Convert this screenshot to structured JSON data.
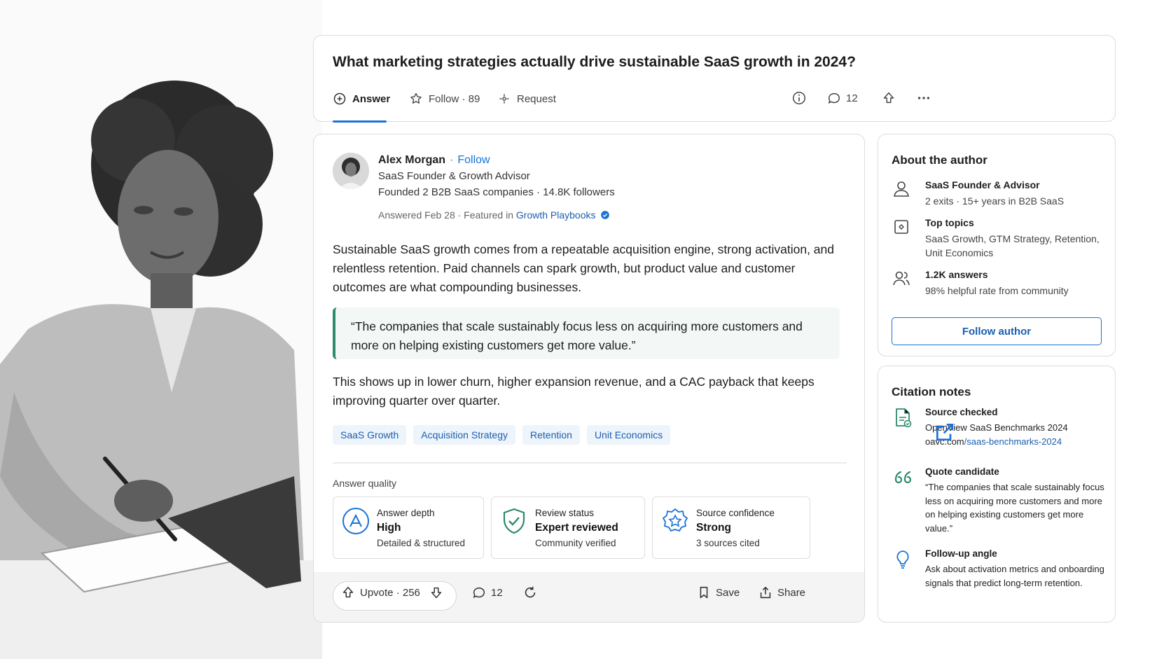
{
  "question": {
    "title": "What marketing strategies actually drive sustainable SaaS growth in 2024?",
    "actions": {
      "answer": "Answer",
      "follow": "Follow · 89",
      "request": "Request",
      "comments": "12"
    }
  },
  "answer": {
    "author": {
      "name": "Alex Morgan",
      "sep": "·",
      "follow": "Follow",
      "title": "SaaS Founder & Growth Advisor",
      "bio": "Founded 2 B2B SaaS companies · 14.8K followers",
      "meta_prefix": "Answered Feb 28 · Featured in ",
      "meta_link": "Growth Playbooks"
    },
    "paragraph1": "Sustainable SaaS growth comes from a repeatable acquisition engine, strong activation, and relentless retention. Paid channels can spark growth, but product value and customer outcomes are what compounding businesses.",
    "quote": "“The companies that scale sustainably focus less on acquiring more customers and more on helping existing customers get more value.”",
    "paragraph2": "This shows up in lower churn, higher expansion revenue, and a CAC payback that keeps improving quarter over quarter.",
    "tags": [
      "SaaS Growth",
      "Acquisition Strategy",
      "Retention",
      "Unit Economics"
    ],
    "quality_label": "Answer quality",
    "quality": [
      {
        "label": "Answer depth",
        "value": "High",
        "note": "Detailed & structured"
      },
      {
        "label": "Review status",
        "value": "Expert reviewed",
        "note": "Community verified"
      },
      {
        "label": "Source confidence",
        "value": "Strong",
        "note": "3 sources cited"
      }
    ],
    "footer": {
      "upvote": "Upvote · 256",
      "comments": "12",
      "save": "Save",
      "share": "Share"
    }
  },
  "about": {
    "heading": "About the author",
    "items": [
      {
        "title": "SaaS Founder & Advisor",
        "desc": "2 exits · 15+ years in B2B SaaS"
      },
      {
        "title": "Top topics",
        "desc": "SaaS Growth, GTM Strategy, Retention, Unit Economics"
      },
      {
        "title": "1.2K answers",
        "desc": "98% helpful rate from community"
      }
    ],
    "follow_button": "Follow author"
  },
  "citations": {
    "heading": "Citation notes",
    "source": {
      "title": "Source checked",
      "line1": "OpenView SaaS Benchmarks 2024",
      "domain": "oavc.com",
      "path": "/saas-benchmarks-2024"
    },
    "quote": {
      "title": "Quote candidate",
      "desc": "“The companies that scale sustainably focus less on acquiring more customers and more on helping existing customers get more value.”"
    },
    "followup": {
      "title": "Follow-up angle",
      "desc": "Ask about activation metrics and onboarding signals that predict long-term retention."
    }
  },
  "colors": {
    "accent": "#1a73d6",
    "quote_bar": "#2d8a6b",
    "tag_bg": "#eef4fb"
  }
}
